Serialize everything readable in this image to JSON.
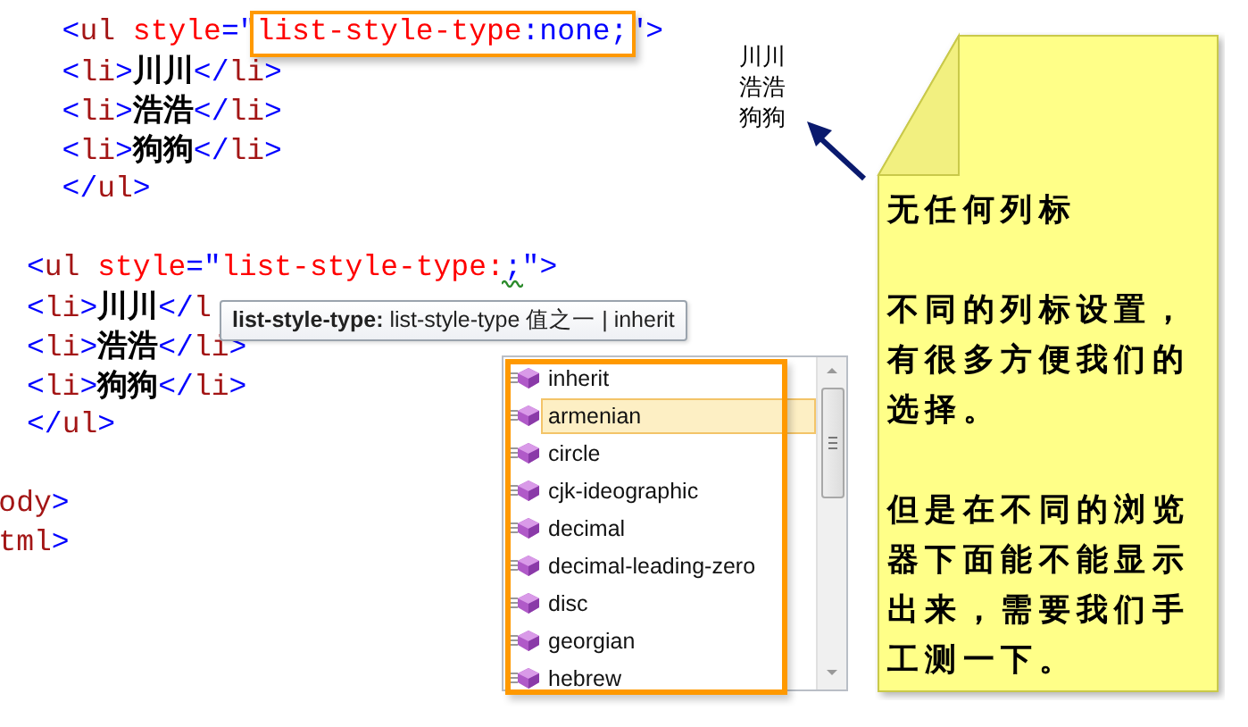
{
  "code_lines": [
    {
      "kind": "code",
      "indented": true,
      "tokens": [
        {
          "text": "<",
          "kind": "bracket"
        },
        {
          "text": "ul",
          "kind": "tag"
        },
        {
          "text": " style",
          "kind": "attr"
        },
        {
          "text": "=\"",
          "kind": "bracket"
        },
        {
          "text": "list-style-type",
          "kind": "css-prop",
          "boxed": true
        },
        {
          "text": ":none;",
          "kind": "css-value",
          "boxed": true
        },
        {
          "text": "\">",
          "kind": "bracket"
        }
      ]
    },
    {
      "kind": "code",
      "indented": true,
      "tokens": [
        {
          "text": "<",
          "kind": "bracket"
        },
        {
          "text": "li",
          "kind": "tag"
        },
        {
          "text": ">",
          "kind": "bracket"
        },
        {
          "text": "川川",
          "kind": "text"
        },
        {
          "text": "</",
          "kind": "bracket"
        },
        {
          "text": "li",
          "kind": "tag"
        },
        {
          "text": ">",
          "kind": "bracket"
        }
      ]
    },
    {
      "kind": "code",
      "indented": true,
      "tokens": [
        {
          "text": "<",
          "kind": "bracket"
        },
        {
          "text": "li",
          "kind": "tag"
        },
        {
          "text": ">",
          "kind": "bracket"
        },
        {
          "text": "浩浩",
          "kind": "text"
        },
        {
          "text": "</",
          "kind": "bracket"
        },
        {
          "text": "li",
          "kind": "tag"
        },
        {
          "text": ">",
          "kind": "bracket"
        }
      ]
    },
    {
      "kind": "code",
      "indented": true,
      "tokens": [
        {
          "text": "<",
          "kind": "bracket"
        },
        {
          "text": "li",
          "kind": "tag"
        },
        {
          "text": ">",
          "kind": "bracket"
        },
        {
          "text": "狗狗",
          "kind": "text"
        },
        {
          "text": "</",
          "kind": "bracket"
        },
        {
          "text": "li",
          "kind": "tag"
        },
        {
          "text": ">",
          "kind": "bracket"
        }
      ]
    },
    {
      "kind": "code",
      "indented": true,
      "tokens": [
        {
          "text": "</",
          "kind": "bracket"
        },
        {
          "text": "ul",
          "kind": "tag"
        },
        {
          "text": ">",
          "kind": "bracket"
        }
      ]
    },
    {
      "kind": "blank"
    },
    {
      "kind": "code",
      "indented": false,
      "tokens": [
        {
          "text": "<",
          "kind": "bracket"
        },
        {
          "text": "ul",
          "kind": "tag"
        },
        {
          "text": " style",
          "kind": "attr"
        },
        {
          "text": "=\"",
          "kind": "bracket"
        },
        {
          "text": "list-style-type:",
          "kind": "css-prop"
        },
        {
          "text": ";",
          "kind": "css-value",
          "squiggle": true
        },
        {
          "text": "\">",
          "kind": "bracket"
        }
      ]
    },
    {
      "kind": "code",
      "indented": false,
      "tokens": [
        {
          "text": "<",
          "kind": "bracket"
        },
        {
          "text": "li",
          "kind": "tag"
        },
        {
          "text": ">",
          "kind": "bracket"
        },
        {
          "text": "川川",
          "kind": "text"
        },
        {
          "text": "</",
          "kind": "bracket"
        },
        {
          "text": "l",
          "kind": "tag"
        }
      ]
    },
    {
      "kind": "code",
      "indented": false,
      "tokens": [
        {
          "text": "<",
          "kind": "bracket"
        },
        {
          "text": "li",
          "kind": "tag"
        },
        {
          "text": ">",
          "kind": "bracket"
        },
        {
          "text": "浩浩",
          "kind": "text"
        },
        {
          "text": "</",
          "kind": "bracket"
        },
        {
          "text": "li",
          "kind": "tag"
        },
        {
          "text": ">",
          "kind": "bracket"
        }
      ]
    },
    {
      "kind": "code",
      "indented": false,
      "tokens": [
        {
          "text": "<",
          "kind": "bracket"
        },
        {
          "text": "li",
          "kind": "tag"
        },
        {
          "text": ">",
          "kind": "bracket"
        },
        {
          "text": "狗狗",
          "kind": "text"
        },
        {
          "text": "</",
          "kind": "bracket"
        },
        {
          "text": "li",
          "kind": "tag"
        },
        {
          "text": ">",
          "kind": "bracket"
        }
      ]
    },
    {
      "kind": "code",
      "indented": false,
      "tokens": [
        {
          "text": "</",
          "kind": "bracket"
        },
        {
          "text": "ul",
          "kind": "tag"
        },
        {
          "text": ">",
          "kind": "bracket"
        }
      ]
    },
    {
      "kind": "blank"
    },
    {
      "kind": "code",
      "clipped": true,
      "tokens": [
        {
          "text": "ody",
          "kind": "tag"
        },
        {
          "text": ">",
          "kind": "bracket"
        }
      ]
    },
    {
      "kind": "code",
      "clipped": true,
      "tokens": [
        {
          "text": "tml",
          "kind": "tag"
        },
        {
          "text": ">",
          "kind": "bracket"
        }
      ]
    }
  ],
  "tooltip": {
    "text": "**list-style-type:** list-style-type 值之一 | inherit"
  },
  "completion": {
    "items": [
      {
        "label": "inherit",
        "selected": false
      },
      {
        "label": "armenian",
        "selected": true
      },
      {
        "label": "circle",
        "selected": false
      },
      {
        "label": "cjk-ideographic",
        "selected": false
      },
      {
        "label": "decimal",
        "selected": false
      },
      {
        "label": "decimal-leading-zero",
        "selected": false
      },
      {
        "label": "disc",
        "selected": false
      },
      {
        "label": "georgian",
        "selected": false
      },
      {
        "label": "hebrew",
        "selected": false
      }
    ]
  },
  "preview": {
    "lines": [
      "川川",
      "浩浩",
      "狗狗"
    ]
  },
  "note": {
    "paragraphs": [
      "无任何列标",
      "不同的列标设置，有很多方便我们的选择。",
      "但是在不同的浏览器下面能不能显示出来，需要我们手工测一下。"
    ]
  }
}
